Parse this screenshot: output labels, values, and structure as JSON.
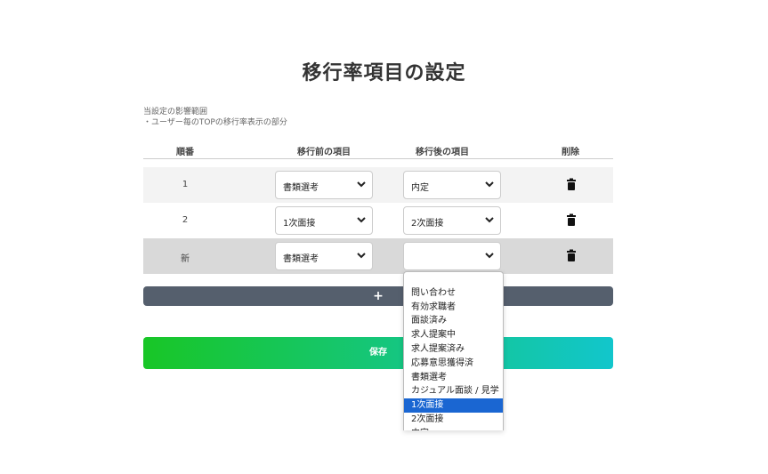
{
  "page": {
    "title": "移行率項目の設定"
  },
  "scope": {
    "line1": "当設定の影響範囲",
    "line2": "・ユーザー毎のTOPの移行率表示の部分"
  },
  "table": {
    "headers": {
      "order": "順番",
      "from": "移行前の項目",
      "to": "移行後の項目",
      "delete": "削除"
    },
    "rows": [
      {
        "order": "1",
        "from": "書類選考",
        "to": "内定"
      },
      {
        "order": "2",
        "from": "1次面接",
        "to": "2次面接"
      },
      {
        "order": "新",
        "from": "書類選考",
        "to": ""
      }
    ]
  },
  "add_button": {
    "label": "+"
  },
  "save_button": {
    "label": "保存"
  },
  "dropdown": {
    "options": [
      "",
      "問い合わせ",
      "有効求職者",
      "面談済み",
      "求人提案中",
      "求人提案済み",
      "応募意思獲得済",
      "書類選考",
      "カジュアル面談 / 見学",
      "1次面接",
      "2次面接",
      "内定"
    ],
    "highlighted": "1次面接"
  },
  "colors": {
    "row_alt": "#f3f3f3",
    "row_new": "#d9d9d9",
    "add_button": "#555f6d",
    "save_gradient_start": "#18c626",
    "save_gradient_end": "#12c6cc",
    "highlight": "#1a66d2"
  },
  "icons": {
    "delete": "trash-icon",
    "select": "chevron-down-icon"
  }
}
